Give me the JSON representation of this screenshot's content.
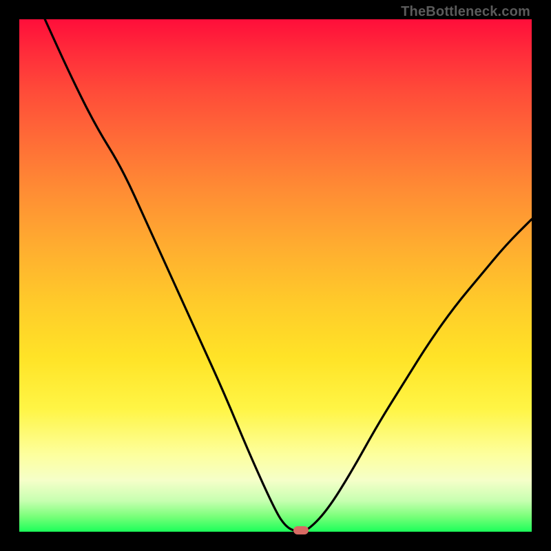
{
  "watermark": "TheBottleneck.com",
  "colors": {
    "gradient_top": "#ff0e3a",
    "gradient_bottom": "#1cff5a",
    "curve": "#000000",
    "marker": "#d86a63",
    "frame": "#000000"
  },
  "chart_data": {
    "type": "line",
    "title": "",
    "xlabel": "",
    "ylabel": "",
    "xlim": [
      0,
      100
    ],
    "ylim": [
      0,
      100
    ],
    "grid": false,
    "series": [
      {
        "name": "bottleneck-curve",
        "x": [
          5,
          10,
          15,
          20,
          25,
          30,
          35,
          40,
          45,
          50,
          52,
          54,
          56,
          60,
          65,
          70,
          75,
          80,
          85,
          90,
          95,
          100
        ],
        "values": [
          100,
          89,
          79,
          71,
          60,
          49,
          38,
          27,
          15,
          4,
          1,
          0,
          0,
          4,
          12,
          21,
          29,
          37,
          44,
          50,
          56,
          61
        ]
      }
    ],
    "annotations": [
      {
        "name": "minimum-marker",
        "x": 55,
        "y": 0
      }
    ]
  }
}
